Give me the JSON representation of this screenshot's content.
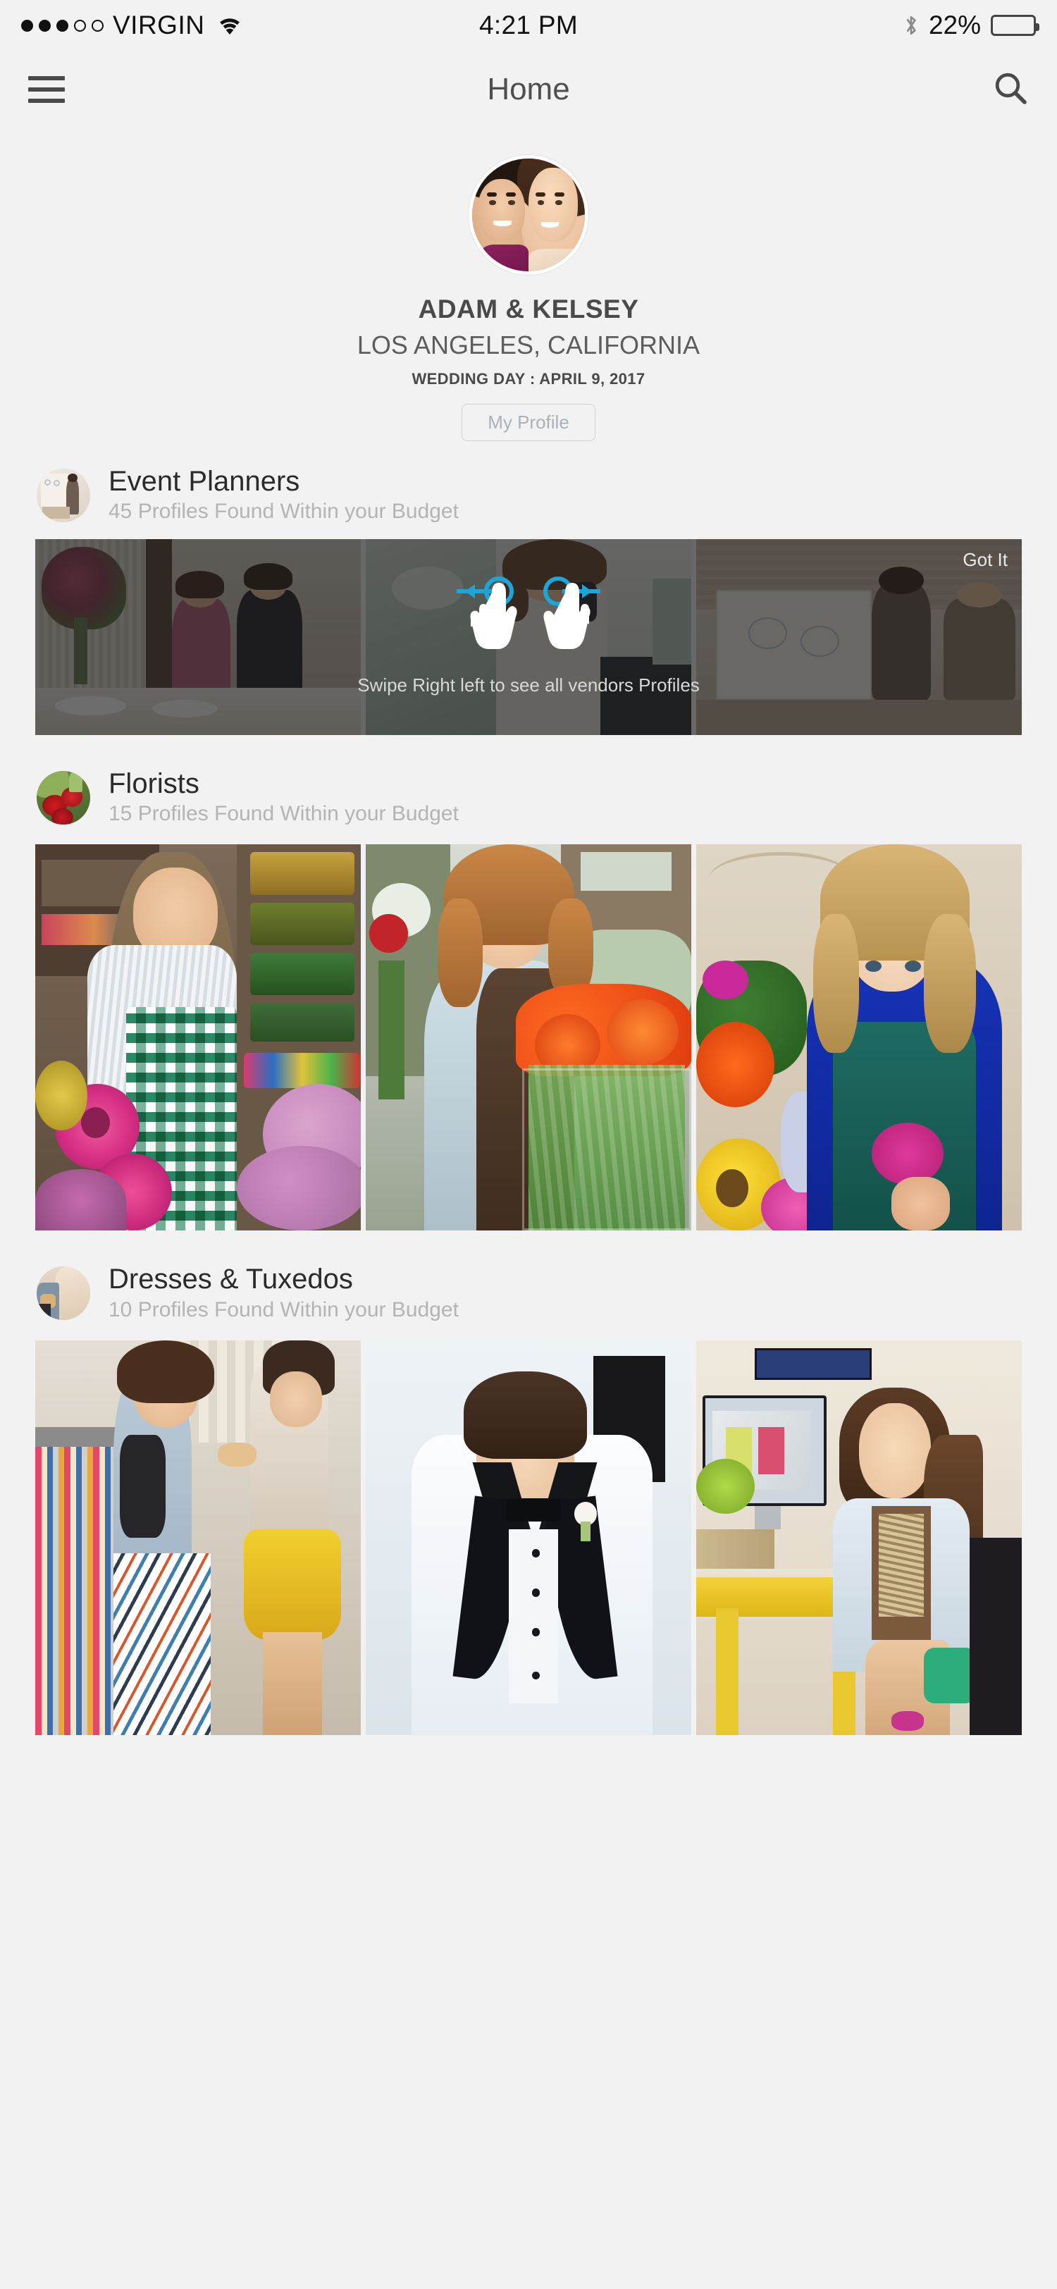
{
  "status_bar": {
    "carrier": "VIRGIN",
    "signal_dots_filled": 3,
    "signal_dots_total": 5,
    "wifi_icon": "wifi-icon",
    "time": "4:21 PM",
    "bluetooth_icon": "bluetooth-icon",
    "battery_percent": "22%",
    "battery_level": 22
  },
  "nav": {
    "menu_icon": "hamburger-menu-icon",
    "title": "Home",
    "search_icon": "search-icon"
  },
  "profile": {
    "avatar_alt": "couple-avatar",
    "names": "ADAM & KELSEY",
    "location": "LOS ANGELES, CALIFORNIA",
    "wedding_day": "WEDDING DAY : APRIL 9, 2017",
    "profile_button": "My Profile"
  },
  "sections": [
    {
      "id": "event-planners",
      "title": "Event Planners",
      "subtitle": "45 Profiles Found Within your Budget",
      "thumb": "event-planner-thumb"
    },
    {
      "id": "florists",
      "title": "Florists",
      "subtitle": "15 Profiles Found Within your Budget",
      "thumb": "florist-thumb"
    },
    {
      "id": "dresses-tuxedos",
      "title": "Dresses & Tuxedos",
      "subtitle": "10 Profiles Found Within your Budget",
      "thumb": "dress-thumb"
    }
  ],
  "tutorial": {
    "got_it_label": "Got It",
    "swipe_text": "Swipe Right left to see all vendors Profiles",
    "arrow_color": "#1ca5d8",
    "hand_color": "#ffffff",
    "overlay_color": "rgba(20,20,20,0.62)"
  },
  "colors": {
    "background": "#f2f2f2",
    "title_text": "#4f4f4f",
    "subtitle_text": "#b4b4b4",
    "heading_text": "#2b2b2b",
    "profile_btn_text": "#a9b2bb"
  }
}
